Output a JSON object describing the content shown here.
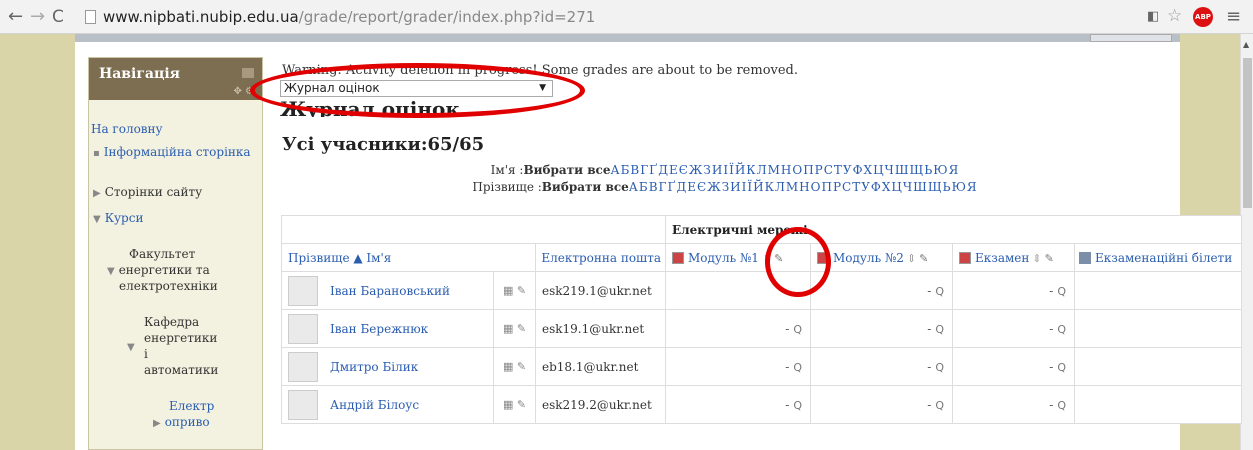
{
  "browser": {
    "url_host": "www.nipbati.nubip.edu.ua",
    "url_path": "/grade/report/grader/index.php?id=271",
    "adblock_label": "ABP"
  },
  "nav": {
    "title": "Навігація",
    "items": [
      "На головну",
      "Інформаційна сторінка",
      "Сторінки сайту",
      "Курси",
      "Факультет",
      "енергетики та",
      "електротехніки",
      "Кафедра",
      "енергетики",
      "і",
      "автоматики",
      "Електр",
      "оприво"
    ]
  },
  "main": {
    "warning": "Warning: Activity deletion in progress! Some grades are about to be removed.",
    "jump_value": "Журнал оцінок",
    "page_title": "Журнал оцінок",
    "participants": "Усі учасники:65/65",
    "firstname_label": "Ім'я :",
    "surname_label": "Прізвище :",
    "select_all": "Вибрати все",
    "alphabet": "АБВГҐДЕЄЖЗИІЇЙКЛМНОПРСТУФХЦЧШЩЬЮЯ"
  },
  "table": {
    "category": "Електричні мережі",
    "col_name": "Прізвище ▲ Ім'я",
    "col_email": "Електронна пошта",
    "col_items": [
      "Модуль №1",
      "Модуль №2",
      "Екзамен",
      "Екзаменаційні білети"
    ],
    "rows": [
      {
        "name": "Іван Барановський",
        "email": "esk219.1@ukr.net",
        "g1": "",
        "g2": "-",
        "g3": "-"
      },
      {
        "name": "Іван Бережнюк",
        "email": "esk19.1@ukr.net",
        "g1": "-",
        "g2": "-",
        "g3": "-"
      },
      {
        "name": "Дмитро Білик",
        "email": "eb18.1@ukr.net",
        "g1": "-",
        "g2": "-",
        "g3": "-"
      },
      {
        "name": "Андрій Білоус",
        "email": "esk219.2@ukr.net",
        "g1": "-",
        "g2": "-",
        "g3": "-"
      }
    ]
  },
  "colors": {
    "highlight": "#e00000",
    "link": "#2a5db0",
    "nav_header": "#7d6e52",
    "page_bg": "#d9d5a8"
  }
}
